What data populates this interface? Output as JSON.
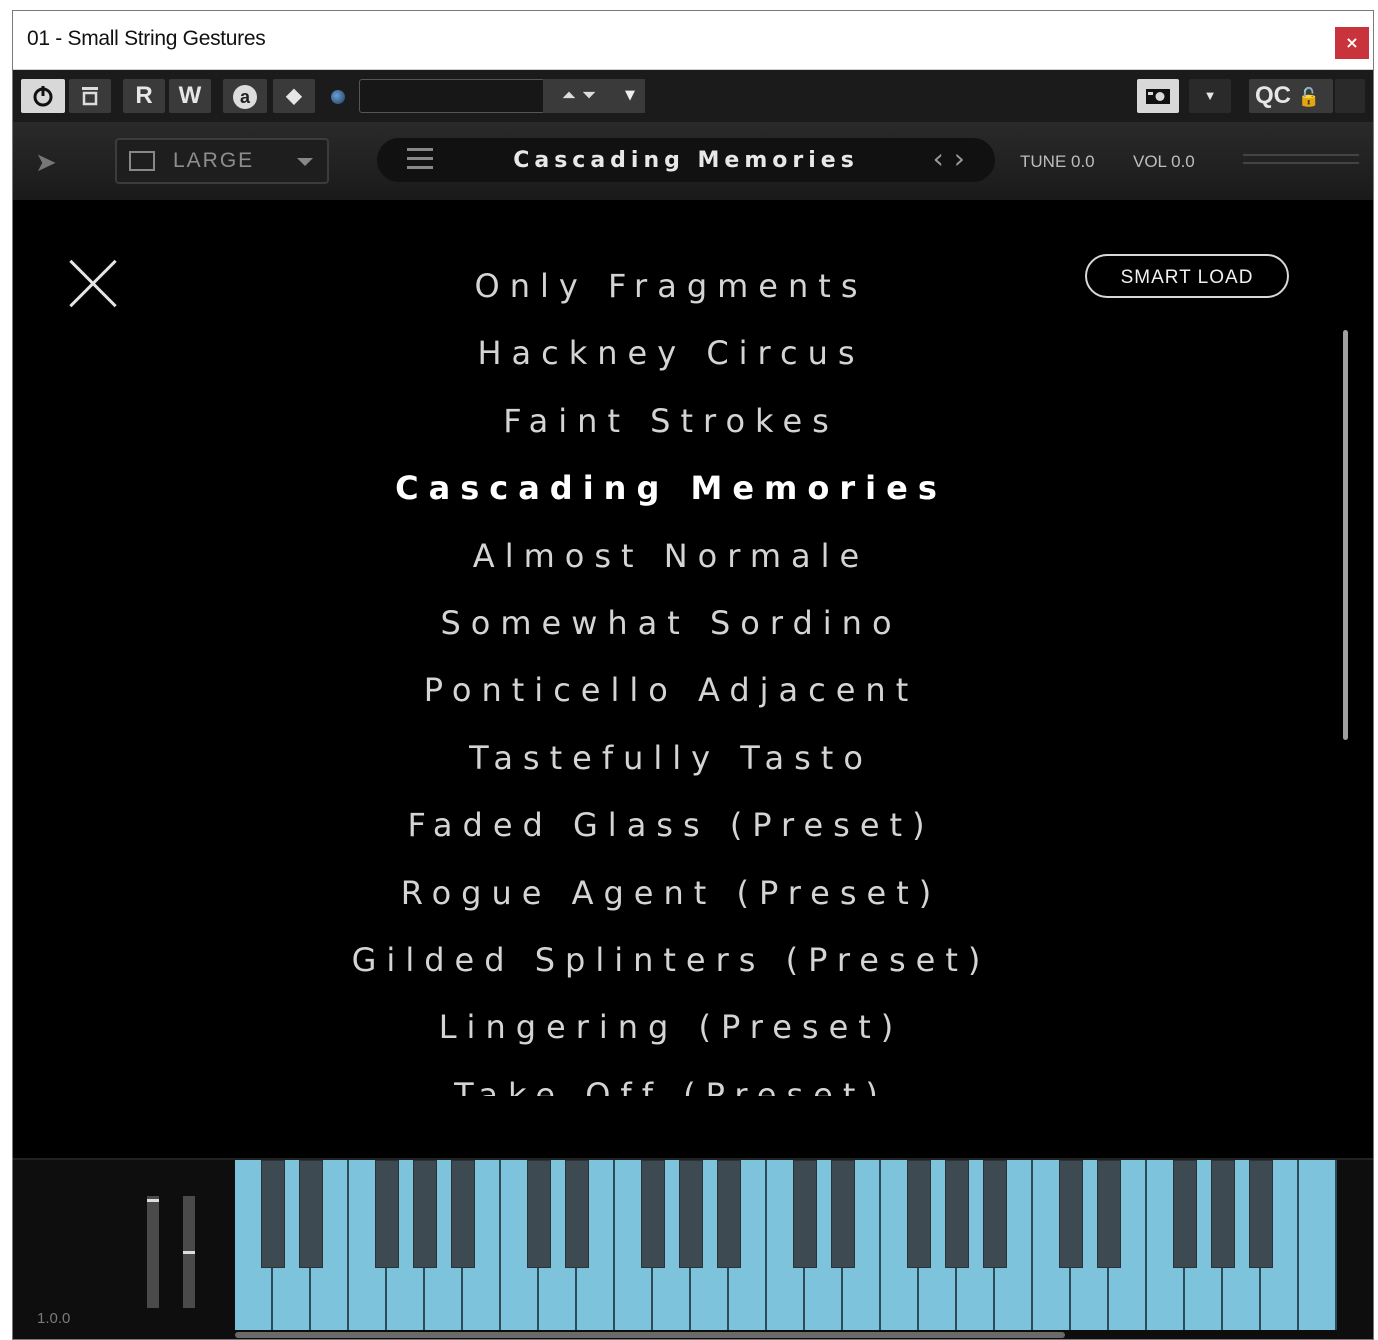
{
  "window": {
    "title": "01 - Small String Gestures",
    "close_label": "×"
  },
  "host_toolbar": {
    "power_icon": "power-icon",
    "compare_icon": "compare-icon",
    "read_label": "R",
    "write_label": "W",
    "a_label": "a",
    "preset_value": "",
    "dropdown_icon": "caret-down-icon",
    "qc_label": "QC"
  },
  "plugin_header": {
    "size_label": "LARGE",
    "current_preset": "Cascading Memories",
    "tune": "TUNE 0.0",
    "vol": "VOL 0.0"
  },
  "browser": {
    "smart_load_label": "SMART LOAD",
    "active_index": 3,
    "presets": [
      "Only Fragments",
      "Hackney Circus",
      "Faint Strokes",
      "Cascading Memories",
      "Almost Normale",
      "Somewhat Sordino",
      "Ponticello Adjacent",
      "Tastefully Tasto",
      "Faded Glass (Preset)",
      "Rogue Agent (Preset)",
      "Gilded Splinters (Preset)",
      "Lingering (Preset)",
      "Take Off (Preset)"
    ]
  },
  "footer": {
    "version": "1.0.0",
    "slider_levels": [
      0.97,
      0.5
    ]
  },
  "colors": {
    "keyboard": "#7cc3db",
    "close_red": "#c9333b",
    "background": "#000000"
  }
}
